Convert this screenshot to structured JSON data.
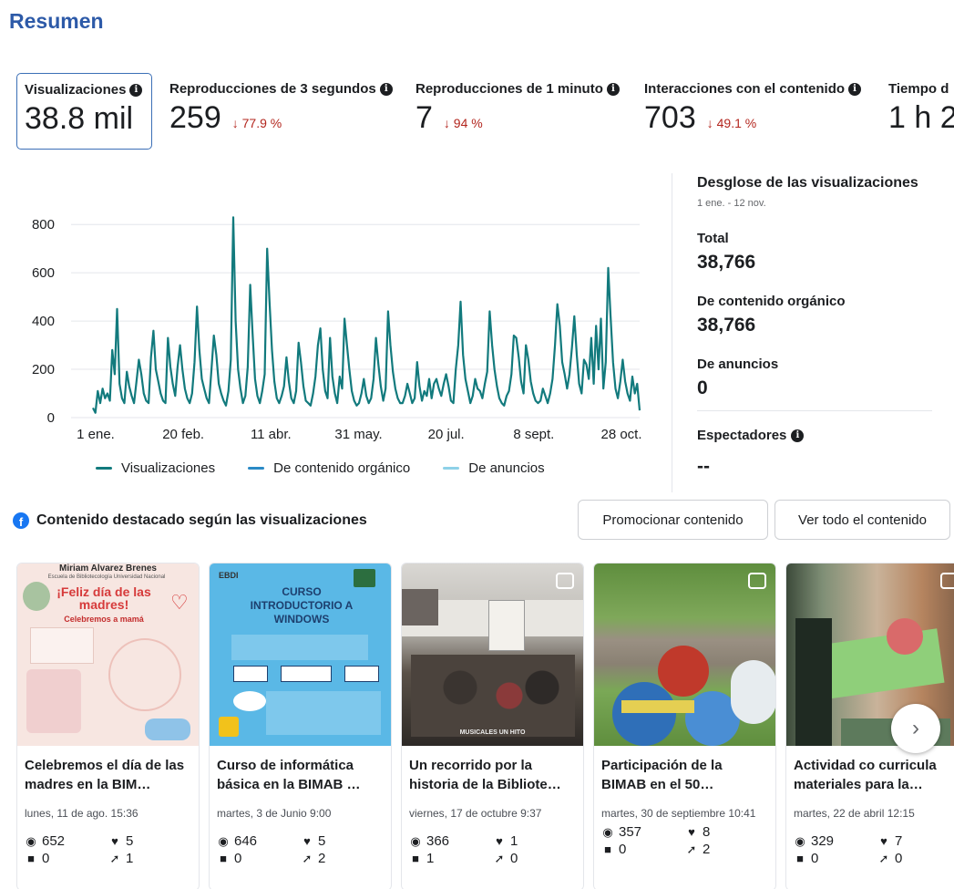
{
  "page": {
    "title": "Resumen"
  },
  "metrics": [
    {
      "label": "Visualizaciones",
      "value": "38.8 mil",
      "change": ""
    },
    {
      "label": "Reproducciones de 3 segundos",
      "value": "259",
      "change": "↓ 77.9 %"
    },
    {
      "label": "Reproducciones de 1 minuto",
      "value": "7",
      "change": "↓ 94 %"
    },
    {
      "label": "Interacciones con el contenido",
      "value": "703",
      "change": "↓ 49.1 %"
    },
    {
      "label": "Tiempo d",
      "value": "1 h 2",
      "change": ""
    }
  ],
  "chart_data": {
    "type": "line",
    "x_ticks": [
      "1 ene.",
      "20 feb.",
      "11 abr.",
      "31 may.",
      "20 jul.",
      "8 sept.",
      "28 oct."
    ],
    "y_ticks": [
      "0",
      "200",
      "400",
      "600",
      "800"
    ],
    "ylim": [
      0,
      850
    ],
    "grid": true,
    "legend_position": "bottom",
    "series": [
      {
        "name": "Visualizaciones",
        "color": "#127a7d",
        "values": [
          40,
          20,
          110,
          60,
          120,
          80,
          100,
          70,
          280,
          180,
          450,
          140,
          80,
          60,
          190,
          130,
          90,
          60,
          150,
          240,
          180,
          100,
          70,
          60,
          250,
          360,
          200,
          150,
          100,
          70,
          60,
          330,
          210,
          140,
          90,
          210,
          300,
          200,
          120,
          80,
          60,
          100,
          230,
          460,
          280,
          160,
          120,
          80,
          60,
          200,
          340,
          260,
          140,
          100,
          70,
          50,
          110,
          240,
          830,
          400,
          200,
          120,
          60,
          90,
          210,
          550,
          350,
          160,
          90,
          60,
          110,
          180,
          700,
          480,
          280,
          150,
          80,
          60,
          90,
          130,
          250,
          150,
          80,
          60,
          110,
          310,
          230,
          130,
          70,
          60,
          50,
          100,
          170,
          300,
          370,
          200,
          110,
          80,
          330,
          170,
          100,
          60,
          170,
          120,
          410,
          300,
          200,
          110,
          70,
          50,
          60,
          100,
          160,
          90,
          60,
          80,
          160,
          330,
          220,
          130,
          70,
          120,
          440,
          300,
          190,
          120,
          80,
          60,
          60,
          90,
          140,
          100,
          60,
          80,
          230,
          130,
          70,
          110,
          90,
          160,
          80,
          140,
          160,
          120,
          90,
          140,
          180,
          130,
          70,
          60,
          200,
          300,
          480,
          260,
          160,
          110,
          60,
          90,
          160,
          120,
          110,
          80,
          140,
          190,
          440,
          300,
          200,
          130,
          80,
          60,
          50,
          90,
          110,
          180,
          340,
          330,
          250,
          150,
          100,
          300,
          240,
          150,
          100,
          70,
          60,
          70,
          120,
          90,
          60,
          100,
          160,
          300,
          470,
          380,
          230,
          180,
          120,
          180,
          290,
          420,
          260,
          140,
          100,
          240,
          220,
          160,
          330,
          140,
          380,
          200,
          410,
          120,
          230,
          620,
          420,
          230,
          120,
          80,
          150,
          240,
          150,
          100,
          70,
          170,
          100,
          140,
          30
        ]
      },
      {
        "name": "De contenido orgánico",
        "color": "#2a8ac6",
        "values": []
      },
      {
        "name": "De anuncios",
        "color": "#8ed1e8",
        "values": []
      }
    ]
  },
  "breakdown": {
    "title": "Desglose de las visualizaciones",
    "date_range": "1 ene. - 12 nov.",
    "total_label": "Total",
    "total_value": "38,766",
    "organic_label": "De contenido orgánico",
    "organic_value": "38,766",
    "ads_label": "De anuncios",
    "ads_value": "0",
    "viewers_label": "Espectadores",
    "viewers_value": "--"
  },
  "featured": {
    "title": "Contenido destacado según las visualizaciones",
    "promote_label": "Promocionar contenido",
    "view_all_label": "Ver todo el contenido",
    "cards": [
      {
        "title": "Celebremos el día de las madres en la BIM…",
        "date": "lunes, 11 de ago. 15:36",
        "views": "652",
        "likes": "5",
        "comments": "0",
        "shares": "1",
        "thumb_color": "#f5e3df"
      },
      {
        "title": "Curso de informática básica en la BIMAB …",
        "date": "martes, 3 de Junio 9:00",
        "views": "646",
        "likes": "5",
        "comments": "0",
        "shares": "2",
        "thumb_color": "#58b7e4"
      },
      {
        "title": "Un recorrido por la historia de la Bibliote…",
        "date": "viernes, 17 de octubre 9:37",
        "views": "366",
        "likes": "1",
        "comments": "1",
        "shares": "0",
        "thumb_color": "#4a4a4a"
      },
      {
        "title": "Participación de la BIMAB en el 50…",
        "date": "martes, 30 de septiembre 10:41",
        "views": "357",
        "likes": "8",
        "comments": "0",
        "shares": "2",
        "thumb_color": "#7fa85a"
      },
      {
        "title": "Actividad co curricula materiales para la…",
        "date": "martes, 22 de abril 12:15",
        "views": "329",
        "likes": "7",
        "comments": "0",
        "shares": "0",
        "thumb_color": "#9c7a5e"
      }
    ],
    "thumb_texts": {
      "card1_heading": "Miriam Alvarez Brenes",
      "card1_sub": "Escuela de Bibliotecología Universidad Nacional",
      "card1_title": "¡Feliz día de las madres!",
      "card1_tag": "Celebremos a mamá",
      "card2_brand": "EBDI",
      "card2_title": "CURSO INTRODUCTORIO A WINDOWS",
      "card3_caption": "MUSICALES UN HITO"
    }
  }
}
